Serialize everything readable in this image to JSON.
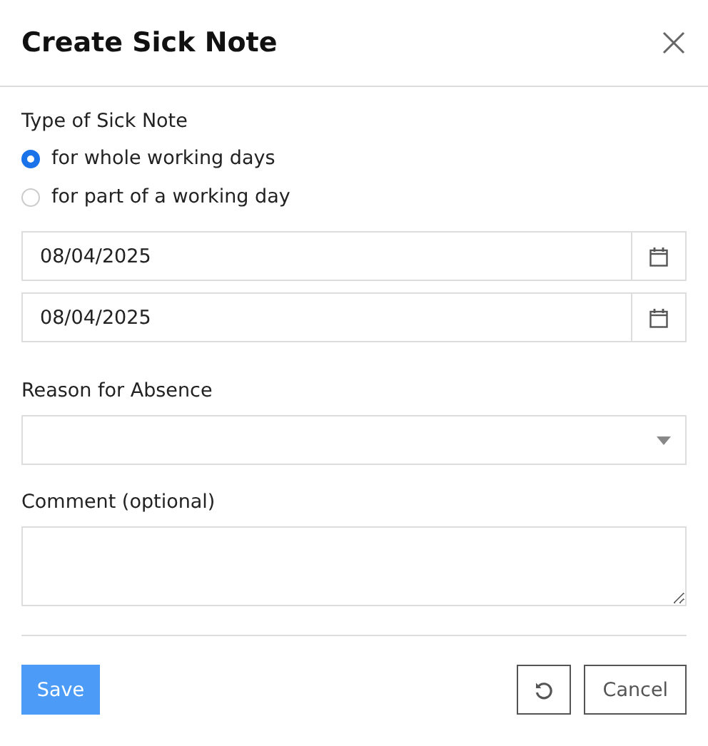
{
  "dialog": {
    "title": "Create Sick Note"
  },
  "sick_note_type": {
    "label": "Type of Sick Note",
    "options": [
      {
        "label": "for whole working days",
        "selected": true
      },
      {
        "label": "for part of a working day",
        "selected": false
      }
    ]
  },
  "dates": [
    {
      "value": "08/04/2025"
    },
    {
      "value": "08/04/2025"
    }
  ],
  "reason": {
    "label": "Reason for Absence"
  },
  "comment": {
    "label": "Comment (optional)"
  },
  "buttons": {
    "save": "Save",
    "cancel": "Cancel"
  }
}
